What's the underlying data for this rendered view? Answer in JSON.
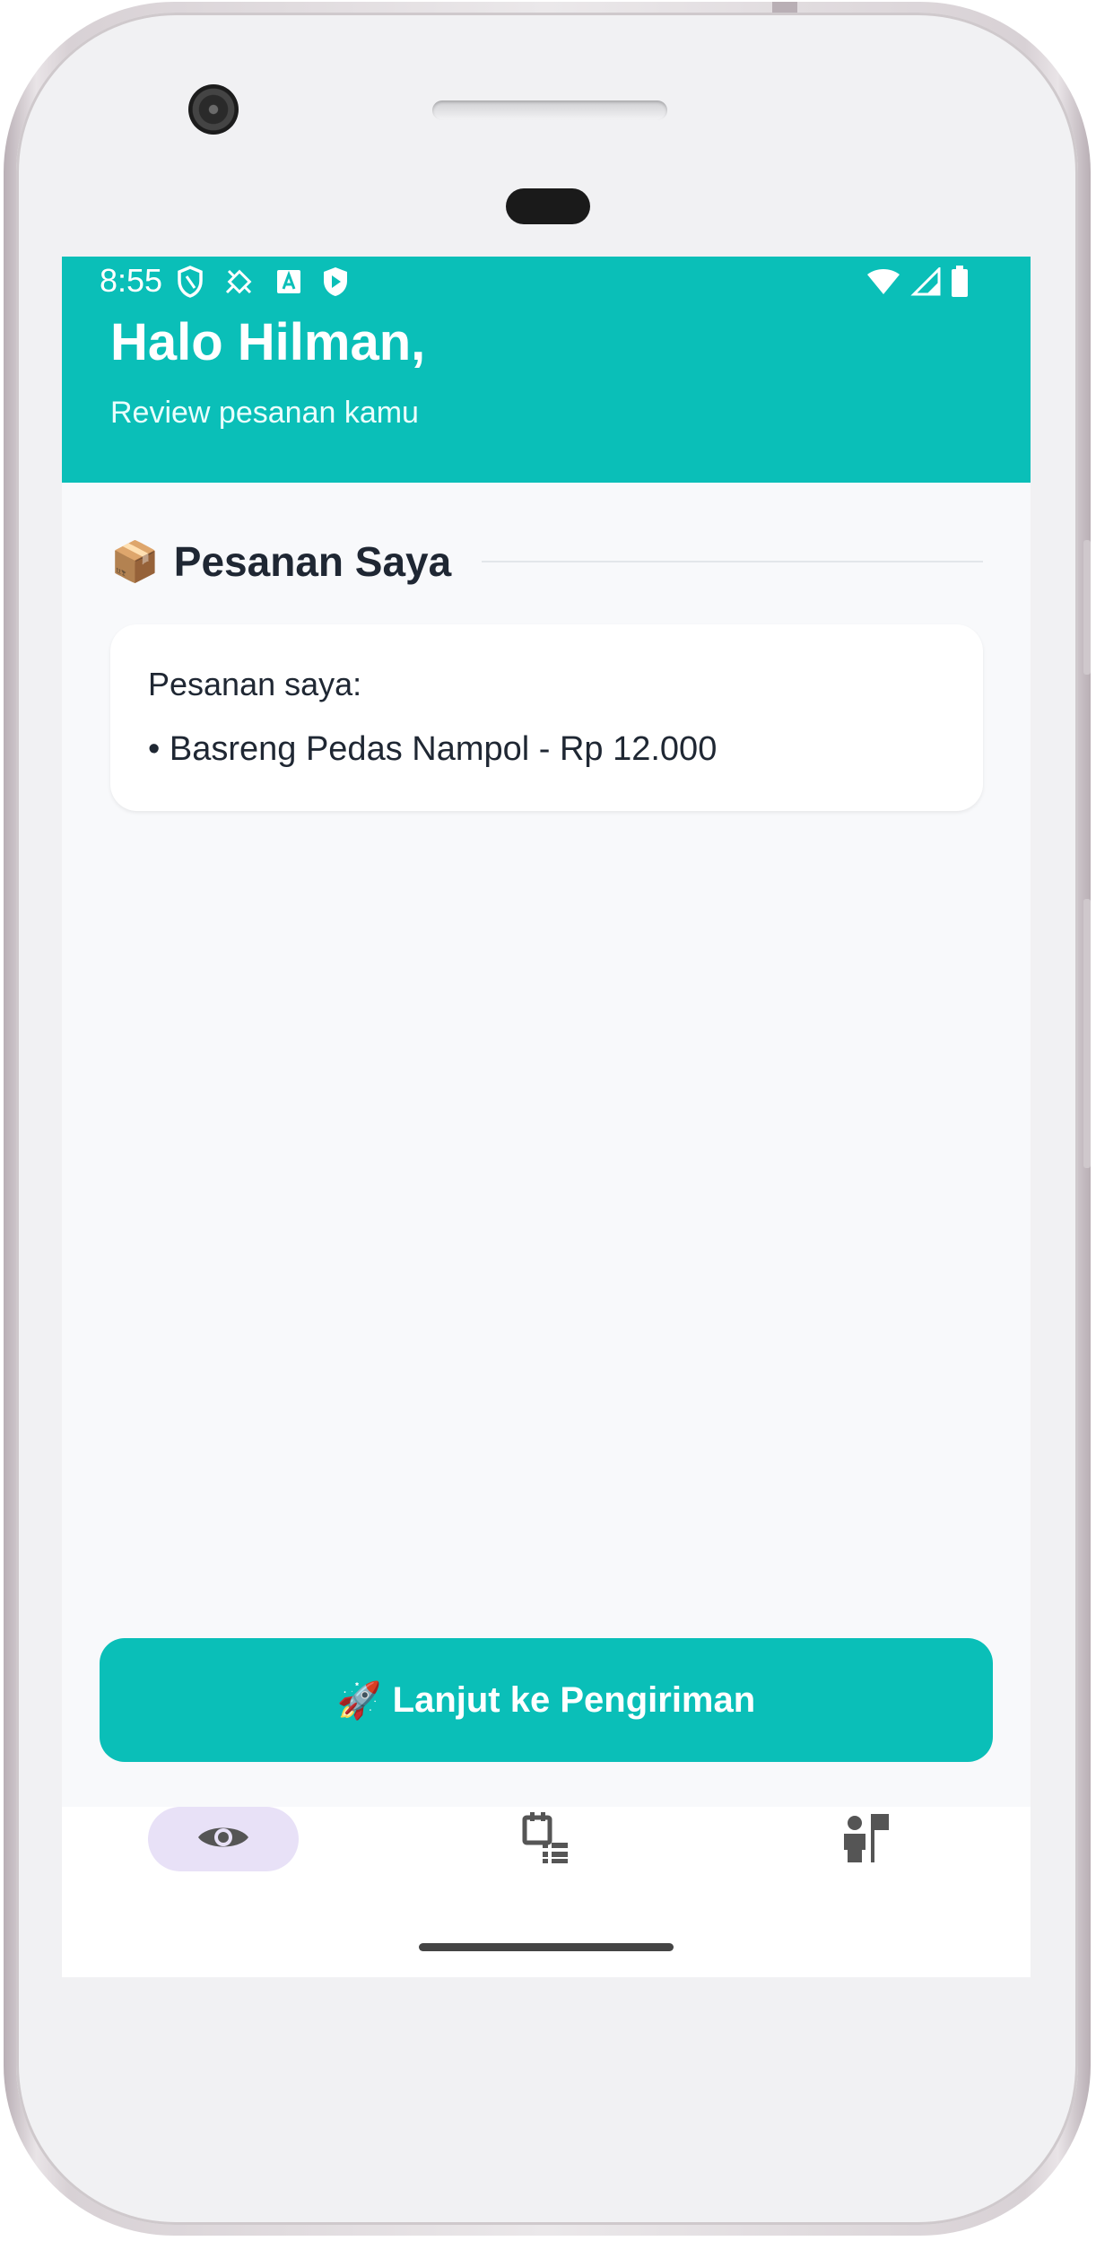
{
  "status_bar": {
    "time": "8:55",
    "left_icons": [
      "shield-icon",
      "satellite-icon",
      "accessibility-a-icon",
      "play-shield-icon"
    ],
    "right_icons": [
      "wifi-icon",
      "cellular-signal-icon",
      "battery-icon"
    ]
  },
  "header": {
    "greeting": "Halo Hilman,",
    "subtitle": "Review pesanan kamu",
    "background_color": "#0abfb8"
  },
  "orders_section": {
    "emoji": "📦",
    "title": "Pesanan Saya",
    "card": {
      "label": "Pesanan saya:",
      "items": [
        "• Basreng Pedas Nampol - Rp 12.000"
      ]
    }
  },
  "continue_button": {
    "emoji": "🚀",
    "label": "Lanjut ke Pengiriman",
    "color": "#0abfb8"
  },
  "bottom_nav": {
    "items": [
      {
        "icon": "eye-icon",
        "active": true
      },
      {
        "icon": "calendar-list-icon",
        "active": false
      },
      {
        "icon": "user-flag-icon",
        "active": false
      }
    ],
    "active_pill_color": "#e8e1f7"
  }
}
